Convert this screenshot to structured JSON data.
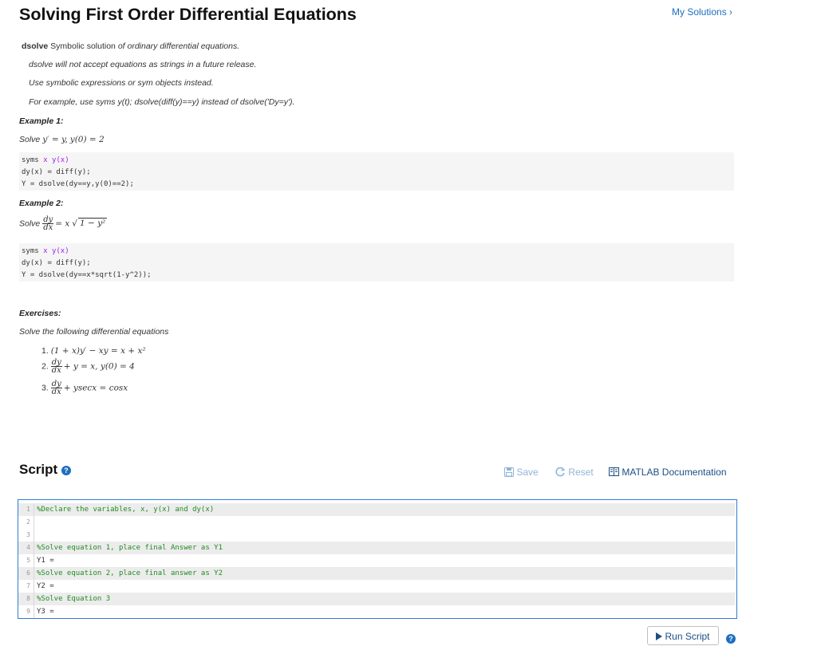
{
  "page": {
    "title": "Solving First Order Differential Equations",
    "my_solutions": "My Solutions",
    "my_solutions_chevron": "›"
  },
  "intro": {
    "dsolve_keyword": "dsolve",
    "dsolve_desc_plain": " Symbolic solution ",
    "dsolve_desc_italic": "of ordinary differential equations.",
    "note1": "dsolve will not accept equations as strings in a future release.",
    "note2": "Use symbolic expressions or sym objects instead.",
    "note3": "For example, use syms y(t); dsolve(diff(y)==y) instead of  dsolve('Dy=y')."
  },
  "example1": {
    "heading": "Example 1:",
    "solve_label": "Solve",
    "eq_lhs": "y′ = y,",
    "eq_rhs": "y(0) = 2",
    "code": {
      "l1_kw": "syms",
      "l1_args": " x y(x)",
      "l2": "dy(x) = diff(y);",
      "l3": "Y = dsolve(dy==y,y(0)==2);"
    }
  },
  "example2": {
    "heading": "Example 2:",
    "solve_label": "Solve",
    "frac_num": "dy",
    "frac_den": "dx",
    "eq_mid": "= x",
    "sqrt_body": "1 − y²",
    "code": {
      "l1_kw": "syms",
      "l1_args": " x y(x)",
      "l2": "dy(x) = diff(y);",
      "l3": "Y = dsolve(dy==x*sqrt(1-y^2));"
    }
  },
  "exercises": {
    "heading": "Exercises:",
    "intro": "Solve the following differential equations",
    "items": [
      {
        "num": "1.",
        "eq": "(1 + x)y′ − xy = x + x²"
      },
      {
        "num": "2.",
        "frac_num": "dy",
        "frac_den": "dx",
        "eq": "+ y = x, y(0) = 4"
      },
      {
        "num": "3.",
        "frac_num": "dy",
        "frac_den": "dx",
        "eq": "+ ysecx = cosx"
      }
    ]
  },
  "script": {
    "title": "Script",
    "help_glyph": "?",
    "save_label": "Save",
    "reset_label": "Reset",
    "doc_label": "MATLAB Documentation",
    "run_label": "Run Script",
    "lines": [
      {
        "num": "1",
        "text": "%Declare the variables, x, y(x) and dy(x)"
      },
      {
        "num": "2",
        "text": ""
      },
      {
        "num": "3",
        "text": ""
      },
      {
        "num": "4",
        "text": "%Solve equation 1, place final Answer as Y1"
      },
      {
        "num": "5",
        "text": "Y1 ="
      },
      {
        "num": "6",
        "text": "%Solve equation 2, place final answer as Y2"
      },
      {
        "num": "7",
        "text": "Y2 ="
      },
      {
        "num": "8",
        "text": "%Solve Equation 3"
      },
      {
        "num": "9",
        "text": "Y3 ="
      }
    ]
  },
  "colors": {
    "link": "#1c6fbf",
    "editor_border": "#2f7fd0",
    "comment": "#228b22",
    "keyword_arg": "#a020f0"
  }
}
